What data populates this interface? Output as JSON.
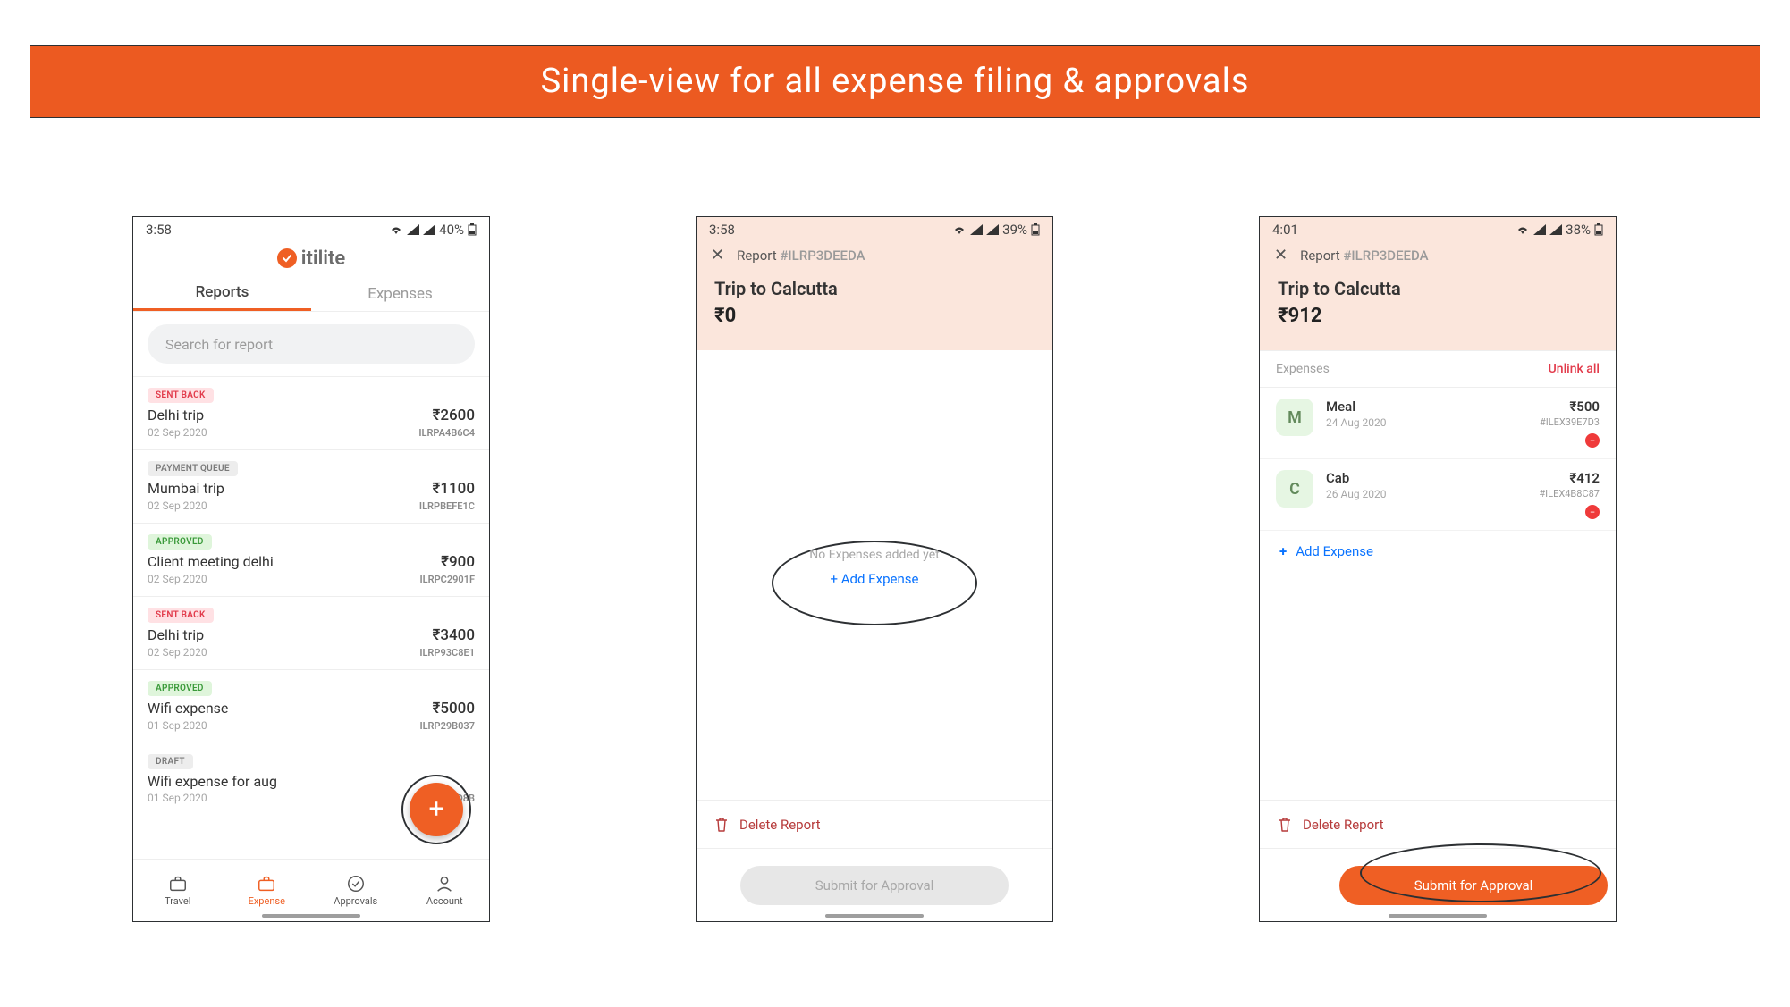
{
  "banner": {
    "title": "Single-view for all expense filing & approvals"
  },
  "screen1": {
    "status": {
      "time": "3:58",
      "battery": "40%"
    },
    "brand": "itilite",
    "tabs": {
      "reports": "Reports",
      "expenses": "Expenses"
    },
    "search_placeholder": "Search for report",
    "reports": [
      {
        "badge": "SENT BACK",
        "badge_cls": "b-sent",
        "title": "Delhi trip",
        "amount": "₹2600",
        "date": "02 Sep 2020",
        "id": "ILRPA4B6C4"
      },
      {
        "badge": "PAYMENT QUEUE",
        "badge_cls": "b-queue",
        "title": "Mumbai trip",
        "amount": "₹1100",
        "date": "02 Sep 2020",
        "id": "ILRPBEFE1C"
      },
      {
        "badge": "APPROVED",
        "badge_cls": "b-appr",
        "title": "Client meeting delhi",
        "amount": "₹900",
        "date": "02 Sep 2020",
        "id": "ILRPC2901F"
      },
      {
        "badge": "SENT BACK",
        "badge_cls": "b-sent",
        "title": "Delhi trip",
        "amount": "₹3400",
        "date": "02 Sep 2020",
        "id": "ILRP93C8E1"
      },
      {
        "badge": "APPROVED",
        "badge_cls": "b-appr",
        "title": "Wifi expense",
        "amount": "₹5000",
        "date": "01 Sep 2020",
        "id": "ILRP29B037"
      },
      {
        "badge": "DRAFT",
        "badge_cls": "b-draft",
        "title": "Wifi expense for aug",
        "amount": "",
        "date": "01 Sep 2020",
        "id": "ILRP40FD8B"
      }
    ],
    "bottom_nav": {
      "travel": "Travel",
      "expense": "Expense",
      "approvals": "Approvals",
      "account": "Account"
    }
  },
  "screen2": {
    "status": {
      "time": "3:58",
      "battery": "39%"
    },
    "header": {
      "report_label": "Report",
      "report_id": "#ILRP3DEEDA",
      "title": "Trip to Calcutta",
      "total": "₹0"
    },
    "empty_text": "No Expenses added yet",
    "add_label": "+ Add Expense",
    "delete_label": "Delete Report",
    "submit_label": "Submit for Approval"
  },
  "screen3": {
    "status": {
      "time": "4:01",
      "battery": "38%"
    },
    "header": {
      "report_label": "Report",
      "report_id": "#ILRP3DEEDA",
      "title": "Trip to Calcutta",
      "total": "₹912"
    },
    "section": {
      "label": "Expenses",
      "unlink": "Unlink all"
    },
    "expenses": [
      {
        "initial": "M",
        "name": "Meal",
        "date": "24 Aug 2020",
        "amount": "₹500",
        "id": "#ILEX39E7D3"
      },
      {
        "initial": "C",
        "name": "Cab",
        "date": "26 Aug 2020",
        "amount": "₹412",
        "id": "#ILEX4B8C87"
      }
    ],
    "add_label": "Add Expense",
    "delete_label": "Delete Report",
    "submit_label": "Submit for Approval"
  }
}
